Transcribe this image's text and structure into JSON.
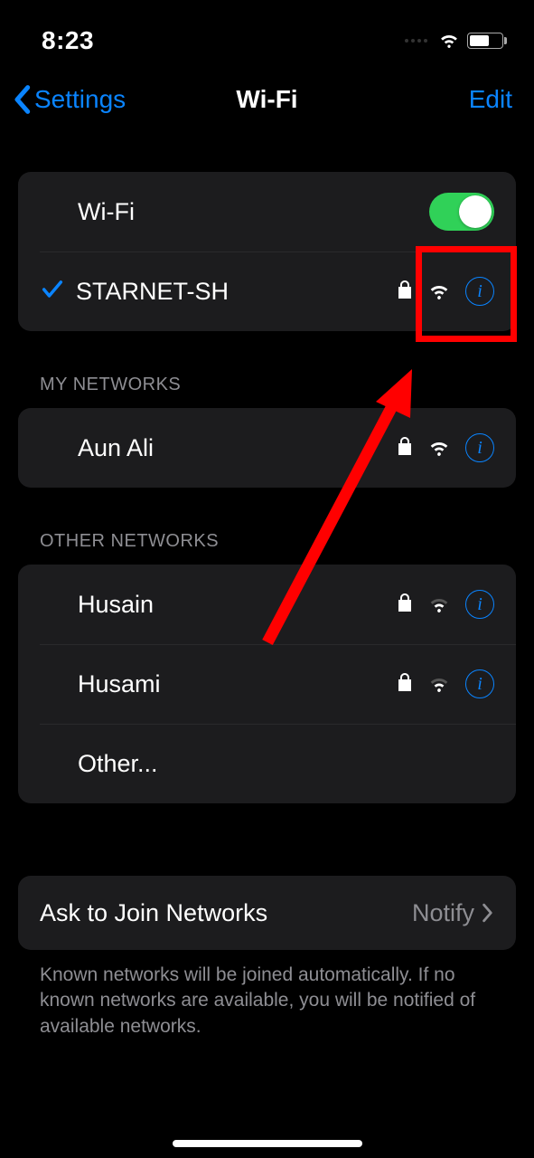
{
  "status": {
    "time": "8:23"
  },
  "nav": {
    "back": "Settings",
    "title": "Wi-Fi",
    "edit": "Edit"
  },
  "wifi": {
    "toggle_label": "Wi-Fi",
    "enabled": true,
    "connected": {
      "name": "STARNET-SH",
      "secured": true
    }
  },
  "sections": {
    "my_label": "MY NETWORKS",
    "my_networks": [
      {
        "name": "Aun Ali",
        "secured": true,
        "signal": "strong"
      }
    ],
    "other_label": "OTHER NETWORKS",
    "other_networks": [
      {
        "name": "Husain",
        "secured": true,
        "signal": "weak"
      },
      {
        "name": "Husami",
        "secured": true,
        "signal": "weak"
      }
    ],
    "other_option": "Other..."
  },
  "ask": {
    "label": "Ask to Join Networks",
    "value": "Notify",
    "footer": "Known networks will be joined automatically. If no known networks are available, you will be notified of available networks."
  }
}
